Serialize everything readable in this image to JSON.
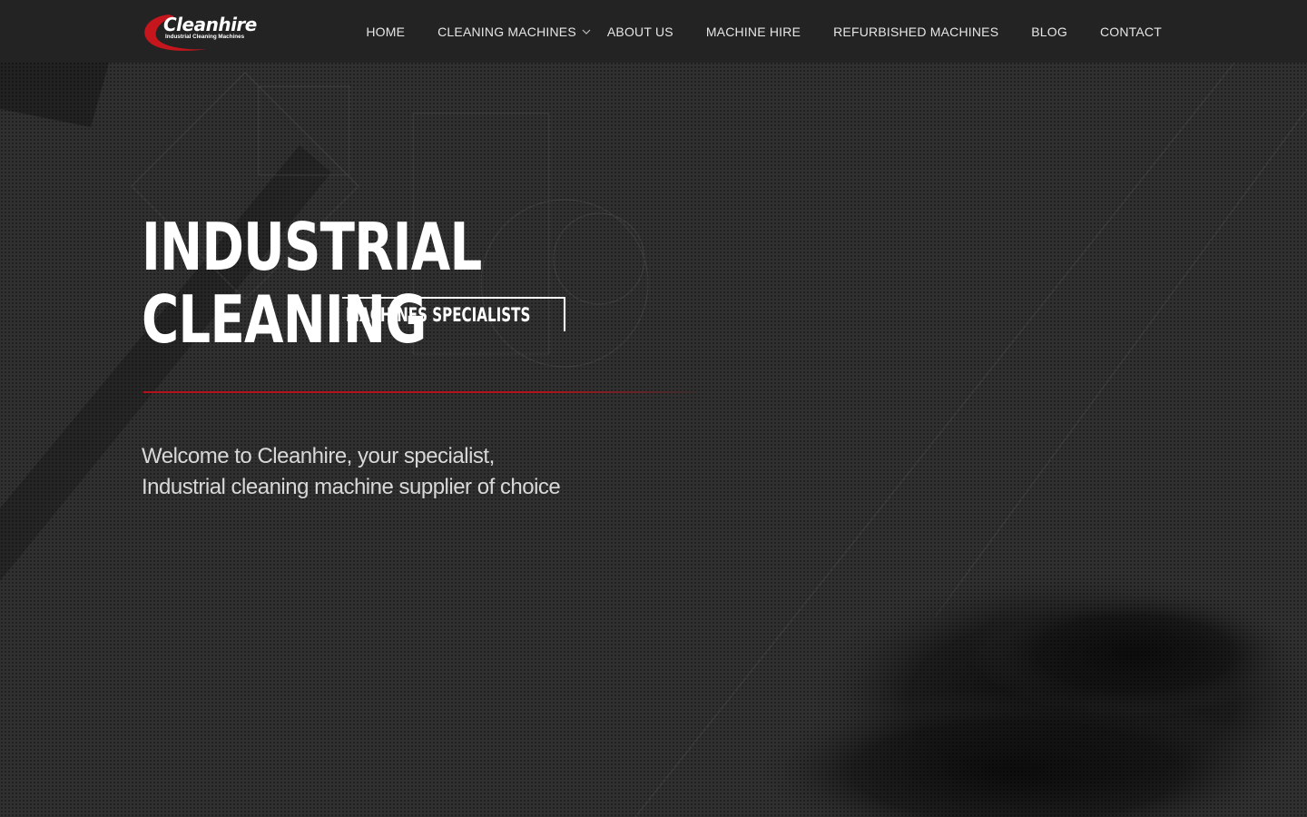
{
  "brand": {
    "name": "Cleanhire",
    "tagline": "Industrial Cleaning Machines",
    "accent": "#b3141b"
  },
  "nav": {
    "items": [
      {
        "label": "HOME"
      },
      {
        "label": "CLEANING MACHINES",
        "has_dropdown": true
      },
      {
        "label": "ABOUT US"
      },
      {
        "label": "MACHINE HIRE"
      },
      {
        "label": "REFURBISHED MACHINES"
      },
      {
        "label": "BLOG"
      },
      {
        "label": "CONTACT"
      }
    ]
  },
  "hero": {
    "line1": "INDUSTRIAL",
    "line2": "CLEANING",
    "badge": "MACHINES SPECIALISTS",
    "welcome": "Welcome to Cleanhire, your specialist, Industrial cleaning machine supplier of choice"
  },
  "colors": {
    "navbar_bg": "#232323",
    "page_bg": "#303030",
    "text": "#ffffff"
  }
}
